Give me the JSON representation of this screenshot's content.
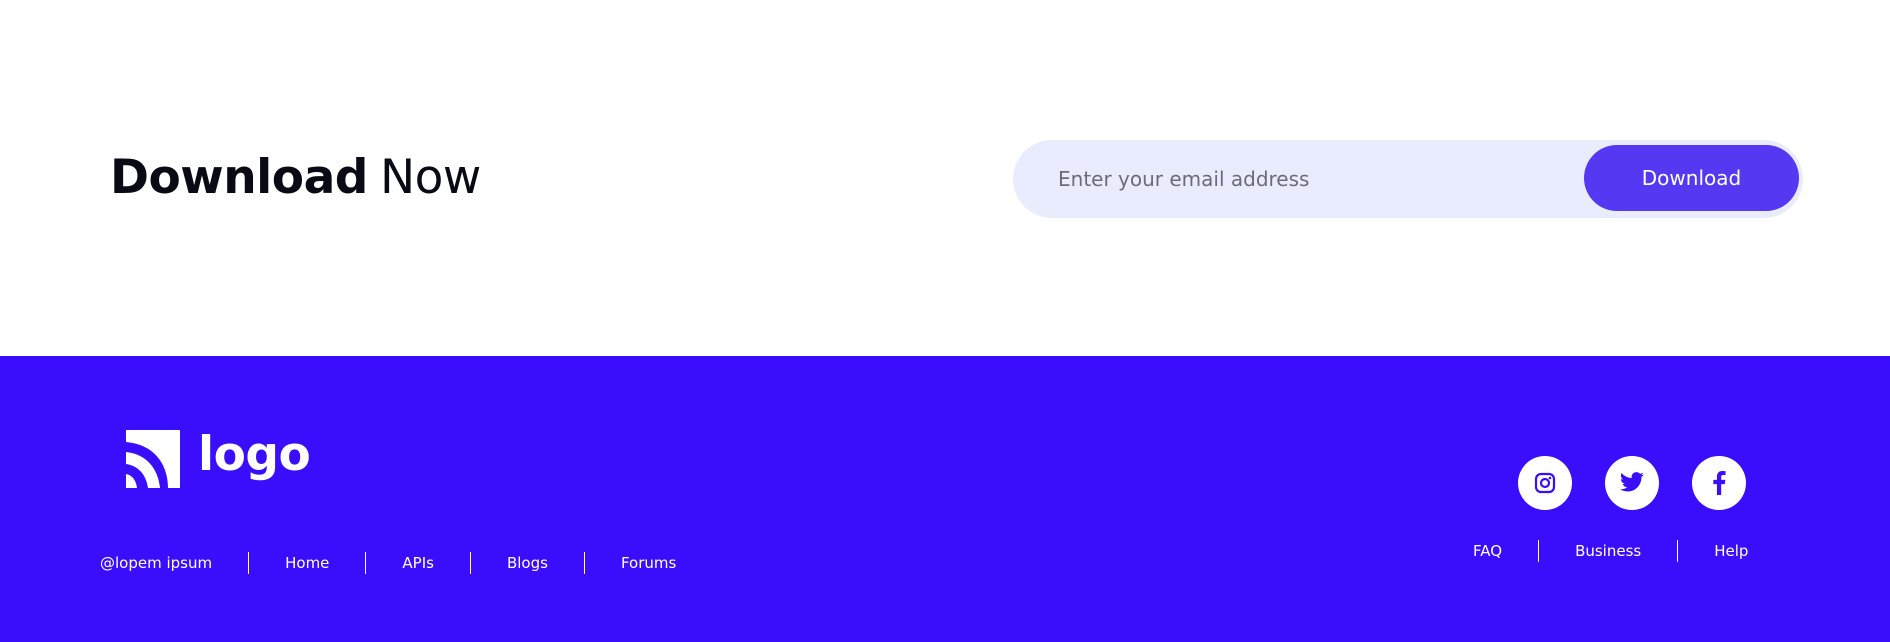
{
  "cta": {
    "title_bold": "Download",
    "title_light": "Now",
    "email_placeholder": "Enter your email address",
    "email_value": "",
    "button_label": "Download"
  },
  "footer": {
    "logo_text": "logo",
    "copyright": "@lopem ipsum",
    "links_left": [
      "Home",
      "APIs",
      "Blogs",
      "Forums"
    ],
    "links_right": [
      "FAQ",
      "Business",
      "Help"
    ],
    "social": [
      {
        "icon": "instagram-icon"
      },
      {
        "icon": "twitter-icon"
      },
      {
        "icon": "facebook-icon"
      }
    ]
  },
  "colors": {
    "accent": "#5438f2",
    "footer_bg": "#3a0efc",
    "input_bg": "#e9ecfc",
    "text_dark": "#0a0a14",
    "white": "#ffffff"
  }
}
